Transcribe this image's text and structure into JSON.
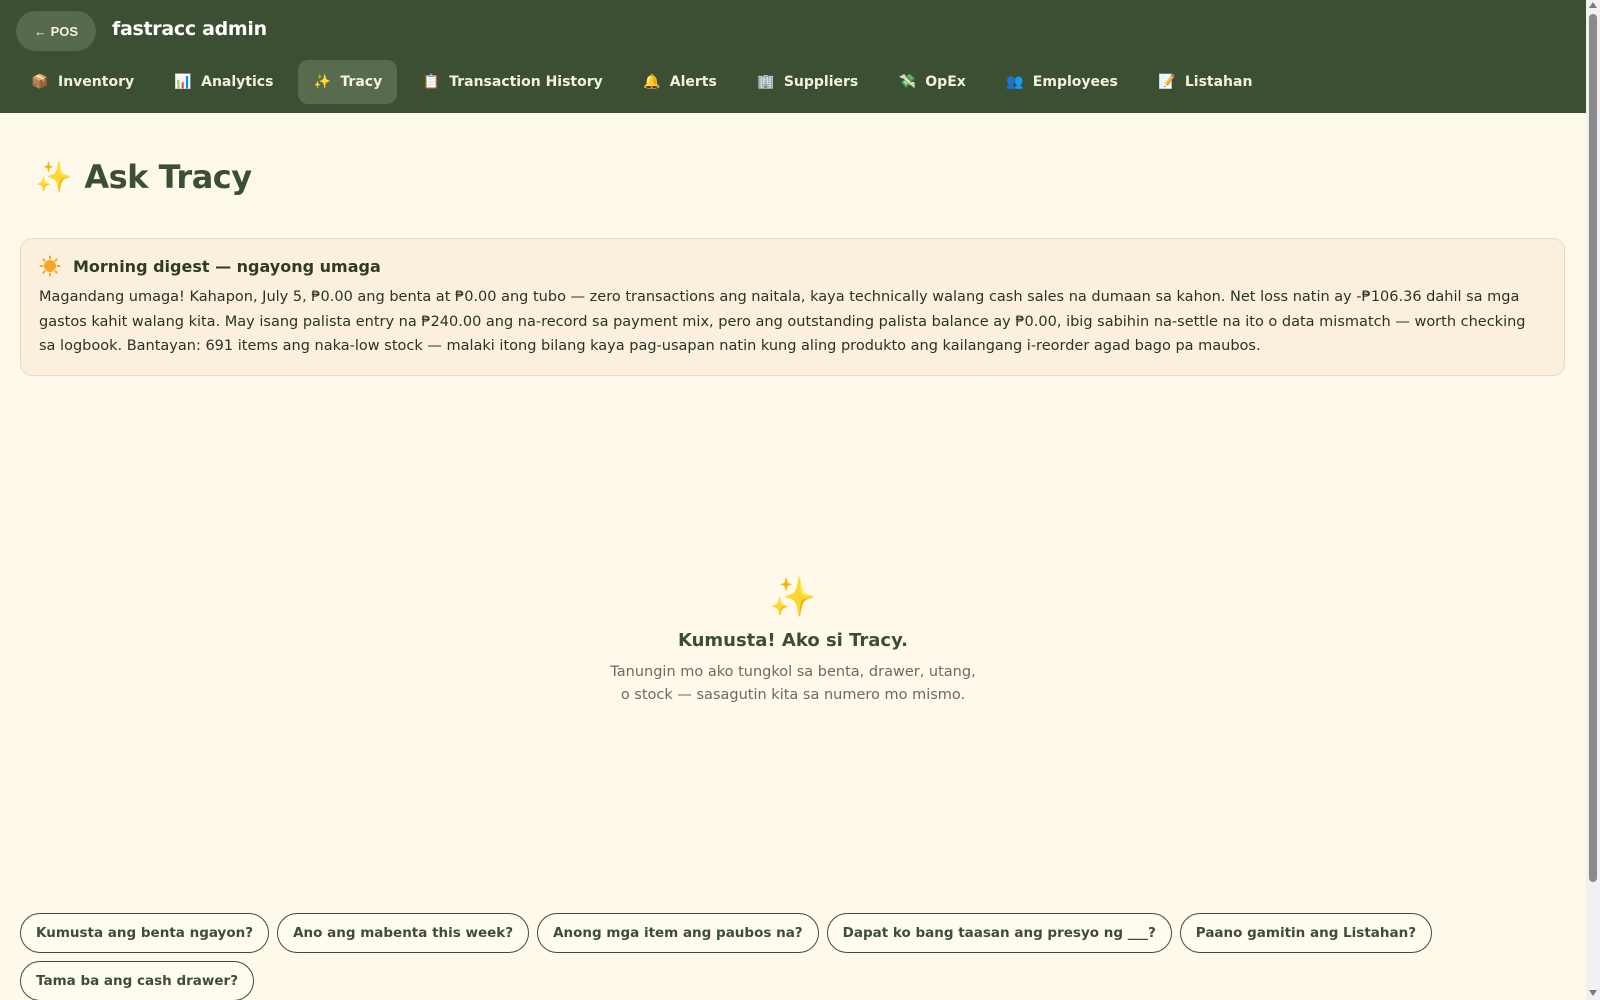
{
  "header": {
    "back_label": "← POS",
    "brand": "fastracc admin",
    "tabs": [
      {
        "label": "Inventory",
        "icon": "package-icon",
        "glyph": "📦",
        "active": false
      },
      {
        "label": "Analytics",
        "icon": "bar-chart-icon",
        "glyph": "📊",
        "active": false
      },
      {
        "label": "Tracy",
        "icon": "sparkles-icon",
        "glyph": "✨",
        "active": true
      },
      {
        "label": "Transaction History",
        "icon": "receipt-icon",
        "glyph": "📋",
        "active": false
      },
      {
        "label": "Alerts",
        "icon": "bell-icon",
        "glyph": "🔔",
        "active": false
      },
      {
        "label": "Suppliers",
        "icon": "building-icon",
        "glyph": "🏢",
        "active": false
      },
      {
        "label": "OpEx",
        "icon": "money-icon",
        "glyph": "💸",
        "active": false
      },
      {
        "label": "Employees",
        "icon": "people-icon",
        "glyph": "👥",
        "active": false
      },
      {
        "label": "Listahan",
        "icon": "notebook-icon",
        "glyph": "📝",
        "active": false
      }
    ]
  },
  "page": {
    "title": "Ask Tracy",
    "title_icon": "✨"
  },
  "digest": {
    "title": "Morning digest — ngayong umaga",
    "body": "Magandang umaga! Kahapon, July 5, ₱0.00 ang benta at ₱0.00 ang tubo — zero transactions ang naitala, kaya technically walang cash sales na dumaan sa kahon. Net loss natin ay -₱106.36 dahil sa mga gastos kahit walang kita. May isang palista entry na ₱240.00 ang na-record sa payment mix, pero ang outstanding palista balance ay ₱0.00, ibig sabihin na-settle na ito o data mismatch — worth checking sa logbook. Bantayan: 691 items ang naka-low stock — malaki itong bilang kaya pag-usapan natin kung aling produkto ang kailangang i-reorder agad bago pa maubos."
  },
  "empty_state": {
    "icon": "✨",
    "heading": "Kumusta! Ako si Tracy.",
    "line1": "Tanungin mo ako tungkol sa benta, drawer, utang,",
    "line2": "o stock — sasagutin kita sa numero mo mismo."
  },
  "suggestions": [
    "Kumusta ang benta ngayon?",
    "Ano ang mabenta this week?",
    "Anong mga item ang paubos na?",
    "Dapat ko bang taasan ang presyo ng ___?",
    "Paano gamitin ang Listahan?",
    "Tama ba ang cash drawer?"
  ],
  "colors": {
    "header_bg": "#3d4f33",
    "page_bg": "#fff9ec",
    "digest_bg": "#fbf0dd",
    "accent": "#3d4f33"
  }
}
